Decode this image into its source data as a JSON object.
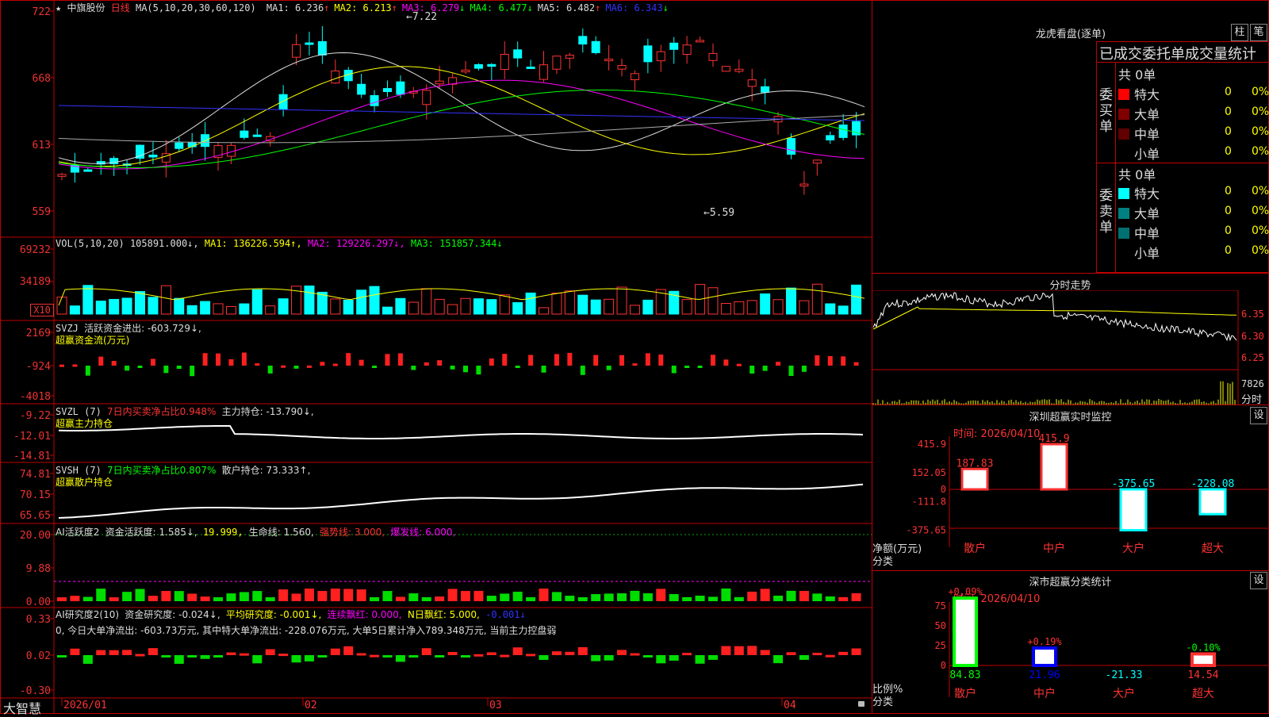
{
  "stock": {
    "star": "★",
    "name": "中旗股份",
    "period": "日线",
    "ma_header": "MA(5,10,20,30,60,120)",
    "ma": [
      {
        "label": "MA1:",
        "value": "6.236",
        "arrow": "↑",
        "color": "#dddddd"
      },
      {
        "label": "MA2:",
        "value": "6.213",
        "arrow": "↑",
        "color": "#ffff00"
      },
      {
        "label": "MA3:",
        "value": "6.279",
        "arrow": "↓",
        "color": "#ff00ff"
      },
      {
        "label": "MA4:",
        "value": "6.477",
        "arrow": "↓",
        "color": "#00ff00"
      },
      {
        "label": "MA5:",
        "value": "6.482",
        "arrow": "↑",
        "color": "#dddddd"
      },
      {
        "label": "MA6:",
        "value": "6.343",
        "arrow": "↓",
        "color": "#3333ff"
      }
    ],
    "y_labels": [
      "722",
      "668",
      "613",
      "559"
    ],
    "high_mark": "7.22",
    "low_mark": "←5.59",
    "high_arrow_prefix": "←"
  },
  "vol": {
    "header": "VOL(5,10,20)",
    "value": "105891.000↓,",
    "ma1": "MA1: 136226.594↑,",
    "ma2": "MA2: 129226.297↓,",
    "ma3": "MA3: 151857.344↓",
    "y_labels": [
      "69232",
      "34189"
    ],
    "unit": "X10"
  },
  "svzj": {
    "header": "SVZJ",
    "line1": "活跃资金进出: -603.729↓,",
    "line2": "超赢资金流(万元)",
    "y_labels": [
      "2169",
      "-924",
      "-4018"
    ]
  },
  "svzl": {
    "header": "SVZL (7)",
    "ratio": "7日内买卖净占比0.948%",
    "pos": "主力持仓: -13.790↓,",
    "line2": "超赢主力持仓",
    "y_labels": [
      "-9.22",
      "-12.01",
      "-14.81"
    ]
  },
  "svsh": {
    "header": "SVSH (7)",
    "ratio": "7日内买卖净占比0.807%",
    "pos": "散户持仓: 73.333↑,",
    "line2": "超赢散户持仓",
    "y_labels": [
      "74.81",
      "70.15",
      "65.65"
    ]
  },
  "ai1": {
    "header": "AI活跃度2",
    "a": "资金活跃度: 1.585↓,",
    "b": "19.999,",
    "c": "生命线: 1.560,",
    "d": "强势线: 3.000,",
    "e": "爆发线: 6.000,",
    "y_labels": [
      "20.00",
      "9.88",
      "0.00"
    ]
  },
  "ai2": {
    "header": "AI研究度2(10)",
    "a": "资金研究度: -0.024↓,",
    "b": "平均研究度: -0.001↓,",
    "c": "连续飘红: 0.000,",
    "d": "N日飘红: 5.000,",
    "e": "-0.001↓",
    "text": "0, 今日大单净流出: -603.73万元, 其中特大单净流出: -228.076万元, 大单5日累计净入789.348万元, 当前主力控盘弱",
    "y_labels": [
      "0.33",
      "0.02",
      "-0.30"
    ]
  },
  "xaxis": [
    "2026/01",
    "02",
    "03",
    "04"
  ],
  "brand": "大智慧",
  "right": {
    "dragon_title": "龙虎看盘(逐单)",
    "btn_zhu": "柱",
    "btn_bi": "笔",
    "stat_title": "已成交委托单成交量统计",
    "buy_side": "委买单",
    "sell_side": "委卖单",
    "buy_total": "共 0单",
    "sell_total": "共 0单",
    "buy_rows": [
      {
        "label": "特大",
        "val": "0",
        "pct": "0%",
        "color": "#ff0000"
      },
      {
        "label": "大单",
        "val": "0",
        "pct": "0%",
        "color": "#800000"
      },
      {
        "label": "中单",
        "val": "0",
        "pct": "0%",
        "color": "#600000"
      },
      {
        "label": "小单",
        "val": "0",
        "pct": "0%",
        "color": "#000000"
      }
    ],
    "sell_rows": [
      {
        "label": "特大",
        "val": "0",
        "pct": "0%",
        "color": "#00ffff"
      },
      {
        "label": "大单",
        "val": "0",
        "pct": "0%",
        "color": "#008080"
      },
      {
        "label": "中单",
        "val": "0",
        "pct": "0%",
        "color": "#007070"
      },
      {
        "label": "小单",
        "val": "0",
        "pct": "0%",
        "color": "#000000"
      }
    ],
    "intraday_title": "分时走势",
    "intraday_y": [
      "6.35",
      "6.30",
      "6.25"
    ],
    "intraday_vol": "7826",
    "intraday_fen": "分时",
    "monitor_title": "深圳超赢实时监控",
    "monitor_btn": "设",
    "monitor_time": "时间: 2026/04/10",
    "monitor_y": [
      "415.9",
      "152.05",
      "0",
      "-111.8",
      "-375.65"
    ],
    "monitor_ylabel": "净额(万元)",
    "monitor_xlabel": "分类",
    "monitor_bars": [
      {
        "cat": "散户",
        "value": 187.83,
        "label": "187.83"
      },
      {
        "cat": "中户",
        "value": 415.9,
        "label": "415.9"
      },
      {
        "cat": "大户",
        "value": -375.65,
        "label": "-375.65"
      },
      {
        "cat": "超大",
        "value": -228.08,
        "label": "-228.08"
      }
    ],
    "class_title": "深市超赢分类统计",
    "class_btn": "设",
    "class_time": "时间: 2026/04/10",
    "class_y": [
      "75",
      "50",
      "25",
      "0"
    ],
    "class_ylabel": "比例%",
    "class_xlabel": "分类",
    "class_bars": [
      {
        "cat": "散户",
        "value": 84.83,
        "label": "84.83",
        "top": "+0.09%"
      },
      {
        "cat": "中户",
        "value": 21.96,
        "label": "21.96",
        "top": "+0.19%"
      },
      {
        "cat": "大户",
        "value": -21.33,
        "label": "-21.33",
        "top": ""
      },
      {
        "cat": "超大",
        "value": 14.54,
        "label": "14.54",
        "top": "-0.10%"
      }
    ]
  }
}
